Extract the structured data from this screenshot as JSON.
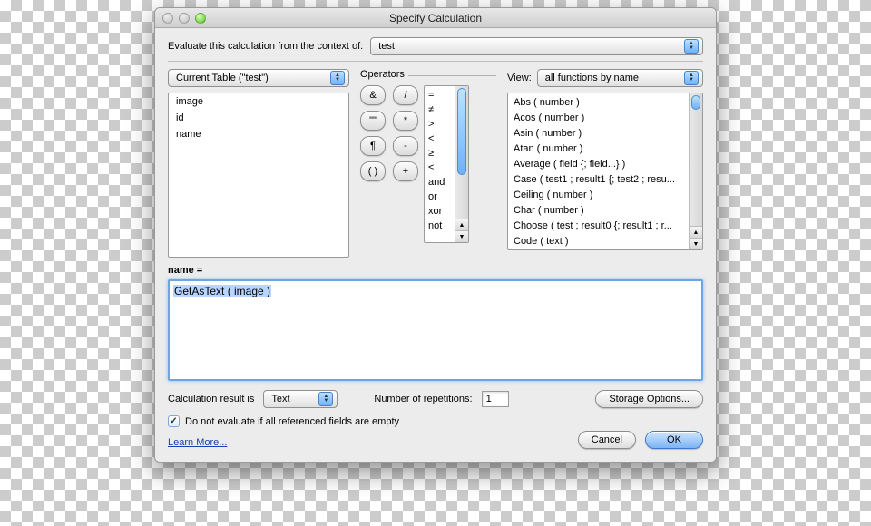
{
  "window": {
    "title": "Specify Calculation"
  },
  "context": {
    "label": "Evaluate this calculation from the context of:",
    "value": "test"
  },
  "table_select": {
    "value": "Current Table (\"test\")"
  },
  "fields": [
    "image",
    "id",
    "name"
  ],
  "operators": {
    "label": "Operators",
    "buttons": [
      "&",
      "/",
      "\"\"",
      "*",
      "¶",
      "-",
      "( )",
      "+"
    ],
    "comparators": [
      "=",
      "≠",
      ">",
      "<",
      "≥",
      "≤",
      "and",
      "or",
      "xor",
      "not"
    ]
  },
  "view": {
    "label": "View:",
    "value": "all functions by name"
  },
  "functions": [
    "Abs ( number )",
    "Acos ( number )",
    "Asin ( number )",
    "Atan ( number )",
    "Average ( field {; field...} )",
    "Case ( test1 ; result1 {; test2 ; resu...",
    "Ceiling ( number )",
    "Char ( number )",
    "Choose ( test ; result0 {; result1 ; r...",
    "Code ( text )"
  ],
  "formula": {
    "label": "name =",
    "value": "GetAsText ( image )"
  },
  "result_type": {
    "label": "Calculation result is",
    "value": "Text"
  },
  "repetitions": {
    "label": "Number of repetitions:",
    "value": "1"
  },
  "storage_button": "Storage Options...",
  "do_not_evaluate": {
    "checked": true,
    "label": "Do not evaluate if all referenced fields are empty"
  },
  "learn_more": "Learn More...",
  "buttons": {
    "cancel": "Cancel",
    "ok": "OK"
  }
}
